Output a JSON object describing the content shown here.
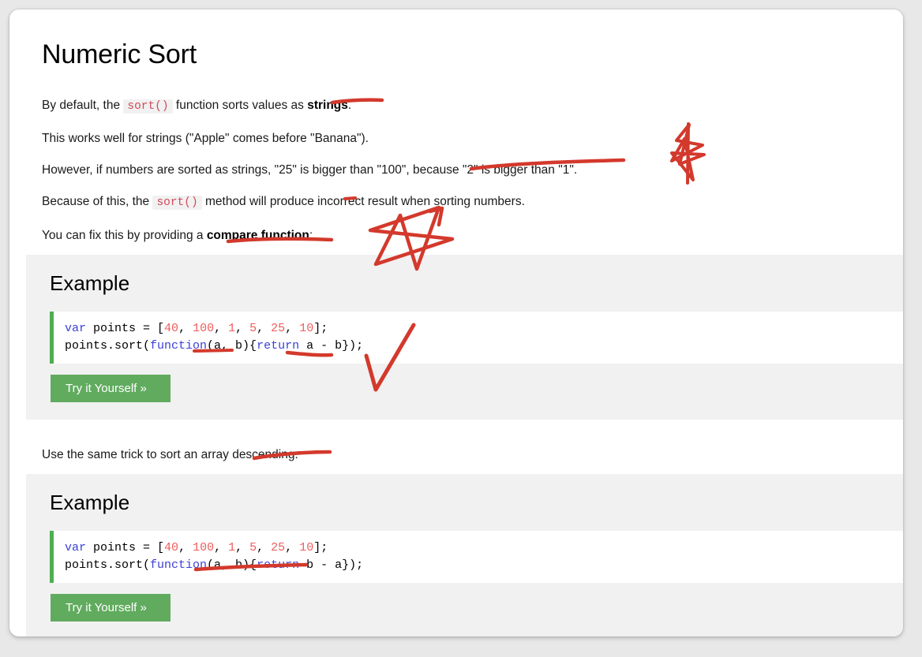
{
  "page": {
    "title": "Numeric Sort"
  },
  "paragraphs": {
    "p1_before": "By default, the ",
    "p1_code": "sort()",
    "p1_mid": " function sorts values as ",
    "p1_bold": "strings",
    "p1_after": ".",
    "p2": "This works well for strings (\"Apple\" comes before \"Banana\").",
    "p3": "However, if numbers are sorted as strings, \"25\" is bigger than \"100\", because \"2\" is bigger than \"1\".",
    "p4_before": "Because of this, the ",
    "p4_code": "sort()",
    "p4_after": " method will produce incorrect result when sorting numbers.",
    "p5_before": "You can fix this by providing a ",
    "p5_bold": "compare function",
    "p5_after": ":",
    "p6": "Use the same trick to sort an array descending:"
  },
  "examples": [
    {
      "heading": "Example",
      "code_line1_kw": "var",
      "code_line1_a": " points = [",
      "code_line1_n1": "40",
      "code_line1_s1": ", ",
      "code_line1_n2": "100",
      "code_line1_s2": ", ",
      "code_line1_n3": "1",
      "code_line1_s3": ", ",
      "code_line1_n4": "5",
      "code_line1_s4": ", ",
      "code_line1_n5": "25",
      "code_line1_s5": ", ",
      "code_line1_n6": "10",
      "code_line1_end": "];",
      "code_line2_a": "points.sort(",
      "code_line2_kw1": "function",
      "code_line2_b": "(a, b){",
      "code_line2_kw2": "return",
      "code_line2_c": " a - b});",
      "button_label": "Try it Yourself »"
    },
    {
      "heading": "Example",
      "code_line1_kw": "var",
      "code_line1_a": " points = [",
      "code_line1_n1": "40",
      "code_line1_s1": ", ",
      "code_line1_n2": "100",
      "code_line1_s2": ", ",
      "code_line1_n3": "1",
      "code_line1_s3": ", ",
      "code_line1_n4": "5",
      "code_line1_s4": ", ",
      "code_line1_n5": "25",
      "code_line1_s5": ", ",
      "code_line1_n6": "10",
      "code_line1_end": "];",
      "code_line2_a": "points.sort(",
      "code_line2_kw1": "function",
      "code_line2_b": "(a, b){",
      "code_line2_kw2": "return",
      "code_line2_c": " b - a});",
      "button_label": "Try it Yourself »"
    }
  ],
  "annotations": {
    "ink_color": "#d3392c",
    "marks": [
      "underline-strings",
      "underline-2-is-bigger-than-1",
      "underline-incorrect",
      "underline-compare-function",
      "underline-descending",
      "underline-a-b-params-1",
      "underline-return-a",
      "underline-return-b-a",
      "star-narrow",
      "star-wide",
      "checkmark"
    ]
  },
  "colors": {
    "page_background": "#e8e8e8",
    "card_background": "#ffffff",
    "example_background": "#f1f1f1",
    "code_border": "#4CAF50",
    "button_green": "#61ab5f",
    "inline_code_text": "#d14b5a",
    "code_keyword": "#3a41d6",
    "code_number": "#ee5c5c"
  }
}
